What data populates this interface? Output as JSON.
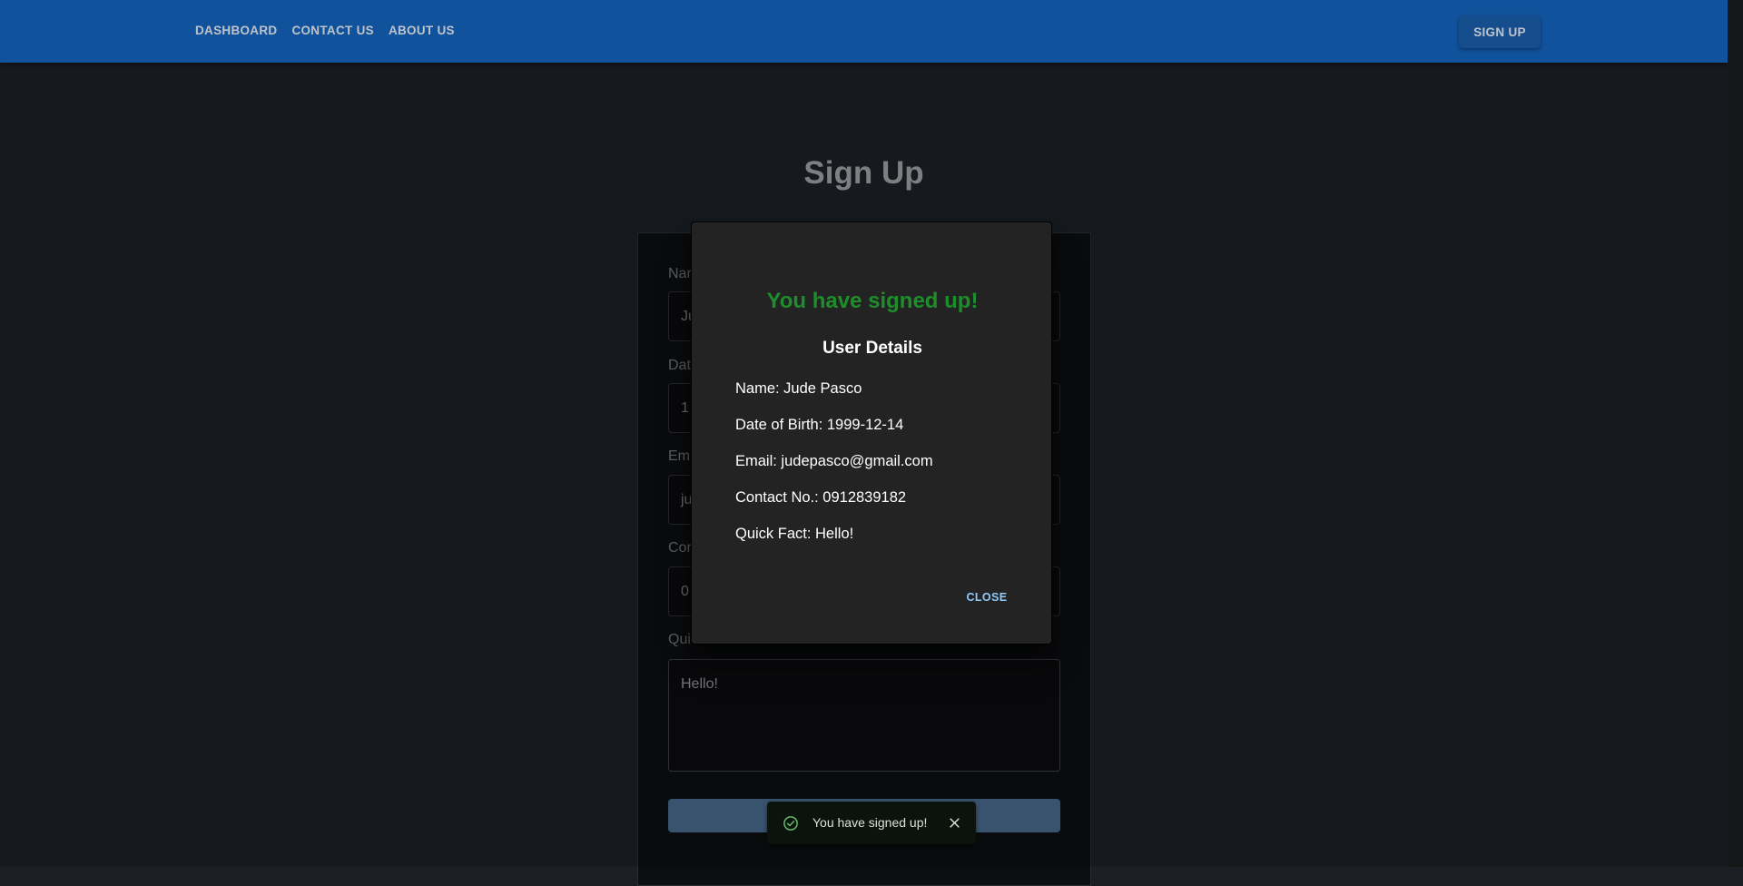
{
  "appbar": {
    "nav": [
      "DASHBOARD",
      "CONTACT US",
      "ABOUT US"
    ],
    "signup_label": "SIGN UP",
    "color": "#1565c0"
  },
  "page": {
    "title": "Sign Up",
    "fields": [
      {
        "label": "Nar",
        "value": "Ju"
      },
      {
        "label": "Dat",
        "value": "1"
      },
      {
        "label": "Em",
        "value": "ju"
      },
      {
        "label": "Cor",
        "value": "0"
      },
      {
        "label": "Qui",
        "value": "Hello!"
      }
    ]
  },
  "dialog": {
    "headline": "You have signed up!",
    "subtitle": "User Details",
    "lines": [
      "Name: Jude Pasco",
      "Date of Birth: 1999-12-14",
      "Email: judepasco@gmail.com",
      "Contact No.: 0912839182",
      "Quick Fact: Hello!"
    ],
    "close_label": "CLOSE",
    "headline_color": "#1e8d2b"
  },
  "snackbar": {
    "message": "You have signed up!",
    "icon": "check-circle-icon",
    "close_icon": "close-icon",
    "color": "#66bb6a"
  }
}
